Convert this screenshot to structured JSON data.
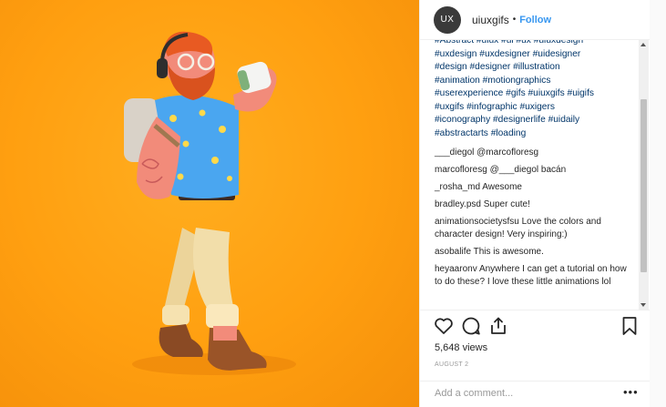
{
  "post": {
    "avatar_text": "UX",
    "username": "uiuxgifs",
    "separator": "•",
    "follow_label": "Follow"
  },
  "caption": {
    "lines": [
      "#Abstract #uiux #ui #ux #uiuxdesign",
      "#uxdesign #uxdesigner #uidesigner",
      "#design #designer #illustration",
      "#animation #motiongraphics",
      "#userexperience #gifs #uiuxgifs #uigifs",
      "#uxgifs #infographic #uxigers",
      "#iconography #designerlife #uidaily",
      "#abstractarts #loading"
    ]
  },
  "comments": [
    {
      "user": "___diegol",
      "text": "@marcofloresg"
    },
    {
      "user": "marcofloresg",
      "text": "@___diegol bacán"
    },
    {
      "user": "_rosha_md",
      "text": "Awesome"
    },
    {
      "user": "bradley.psd",
      "text": "Super cute!"
    },
    {
      "user": "animationsocietysfsu",
      "text": "Love the colors and character design! Very inspiring:)"
    },
    {
      "user": "asobalife",
      "text": "This is awesome."
    },
    {
      "user": "heyaaronv",
      "text": "Anywhere I can get a tutorial on how to do these? I love these little animations lol"
    }
  ],
  "stats": {
    "views": "5,648 views",
    "date": "AUGUST 2"
  },
  "add_comment": {
    "placeholder": "Add a comment..."
  },
  "more_label": "•••",
  "icons": {
    "like": "heart-icon",
    "comment": "comment-bubble-icon",
    "share": "share-icon",
    "save": "bookmark-icon"
  },
  "colors": {
    "background_orange": "#ff9f10",
    "link_blue": "#3897f0",
    "hashtag_navy": "#003569"
  }
}
